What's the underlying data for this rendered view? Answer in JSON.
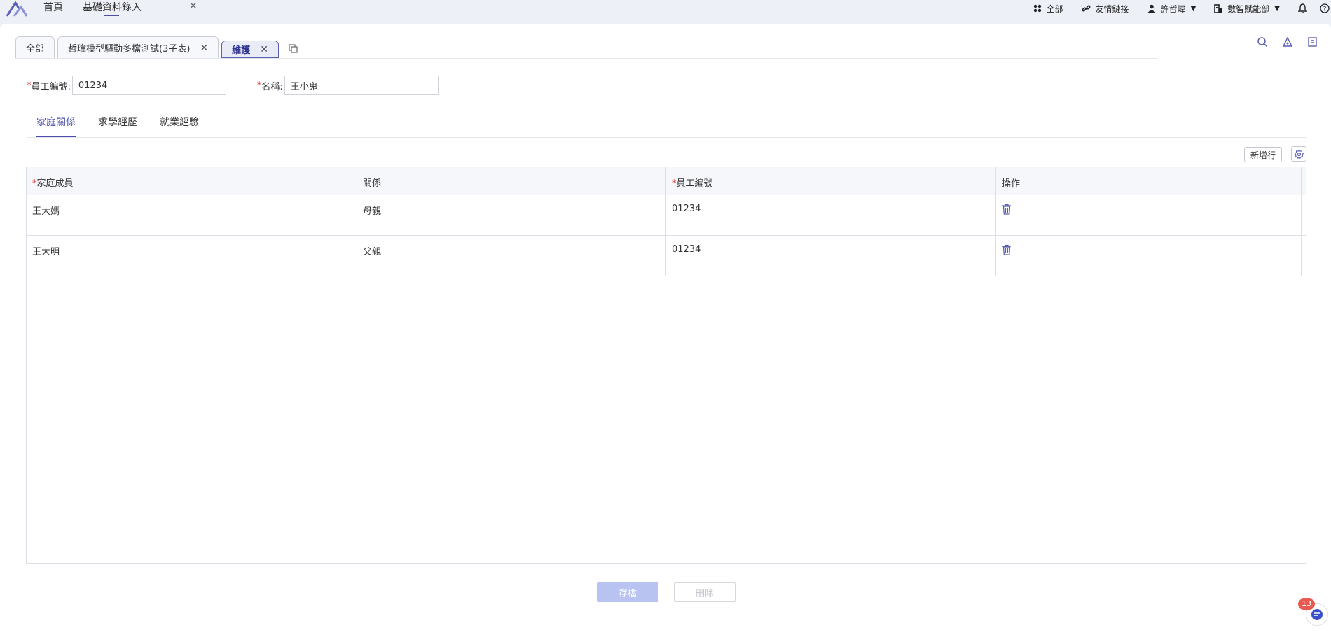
{
  "topbar": {
    "nav": [
      {
        "label": "首頁"
      },
      {
        "label": "基礎資料錄入"
      }
    ],
    "right": {
      "all_label": "全部",
      "links_label": "友情鏈接",
      "user_label": "許哲瑋",
      "dept_label": "數智賦能部"
    }
  },
  "doc_tabs": [
    {
      "label": "全部"
    },
    {
      "label": "哲瑋模型驅動多檔測試(3子表)"
    },
    {
      "label": "維護"
    }
  ],
  "form": {
    "emp_no_label": "員工編號:",
    "emp_no_value": "01234",
    "name_label": "名稱:",
    "name_value": "王小鬼"
  },
  "sub_tabs": [
    {
      "label": "家庭關係"
    },
    {
      "label": "求學經歷"
    },
    {
      "label": "就業經驗"
    }
  ],
  "table": {
    "add_row_label": "新增行",
    "columns": [
      "家庭成員",
      "關係",
      "員工編號",
      "操作"
    ],
    "rows": [
      {
        "member": "王大媽",
        "relation": "母親",
        "emp_no": "01234"
      },
      {
        "member": "王大明",
        "relation": "父親",
        "emp_no": "01234"
      }
    ]
  },
  "actions": {
    "save_label": "存檔",
    "delete_label": "刪除"
  },
  "chat": {
    "badge": "13"
  },
  "colors": {
    "accent": "#4a4fa8",
    "required": "#e03a3a",
    "save_disabled": "#b9c3f2"
  }
}
